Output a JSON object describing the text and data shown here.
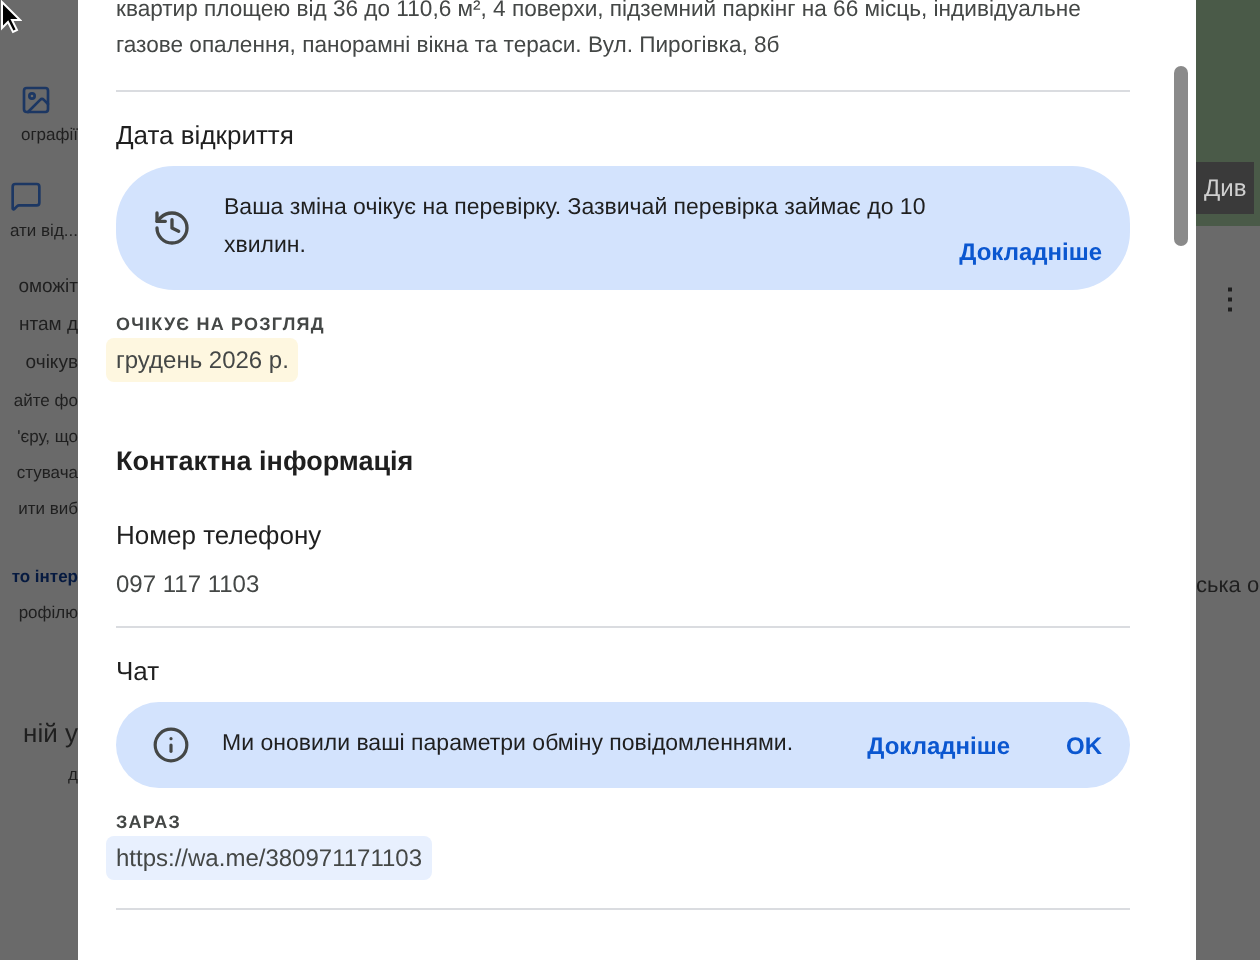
{
  "background": {
    "left_items": [
      {
        "kind": "image-item",
        "text": "ографії"
      },
      {
        "kind": "feedback-item",
        "text": "ати від..."
      },
      {
        "kind": "text",
        "text": "оможіт"
      },
      {
        "kind": "text",
        "text": "нтам д"
      },
      {
        "kind": "text",
        "text": "очікув"
      },
      {
        "kind": "small",
        "text": "айте фо"
      },
      {
        "kind": "small",
        "text": "'єру, що"
      },
      {
        "kind": "small",
        "text": "стувача"
      },
      {
        "kind": "small",
        "text": "ити виб"
      },
      {
        "kind": "link",
        "text": "то інтер"
      },
      {
        "kind": "small",
        "text": "рофілю"
      },
      {
        "kind": "heading",
        "text": "ній у"
      },
      {
        "kind": "small",
        "text": "д"
      }
    ],
    "right_items": [
      {
        "kind": "photo",
        "text": "Див"
      },
      {
        "kind": "more",
        "text": "⋮"
      },
      {
        "kind": "text",
        "text": "ська о"
      }
    ]
  },
  "dialog": {
    "description": "квартир площею від 36 до 110,6 м², 4 поверхи, підземний паркінг на 66 місць, індивідуальне газове опалення, панорамні вікна та тераси. Вул. Пирогівка, 8б",
    "sections": [
      {
        "kind": "field",
        "title": "Дата відкриття",
        "notice": {
          "kind": "pending",
          "text": "Ваша зміна очікує на перевірку. Зазвичай перевірка займає до 10 хвилин.",
          "actions": [
            "Докладніше"
          ]
        },
        "status": "ОЧІКУЄ НА РОЗГЛЯД",
        "value": "грудень 2026 р.",
        "color": "#fef7e0",
        "divider": false
      },
      {
        "kind": "heading",
        "title": "Контактна інформація"
      },
      {
        "kind": "field",
        "title": "Номер телефону",
        "value": "097 117 1103",
        "divider": true
      },
      {
        "kind": "field",
        "title": "Чат",
        "notice": {
          "kind": "info",
          "text": "Ми оновили ваші параметри обміну повідомленнями.",
          "actions": [
            "Докладніше",
            "OK"
          ]
        },
        "status": "ЗАРАЗ",
        "value": "https://wa.me/380971171103",
        "color": "#e8f0fe",
        "divider": true
      }
    ]
  }
}
